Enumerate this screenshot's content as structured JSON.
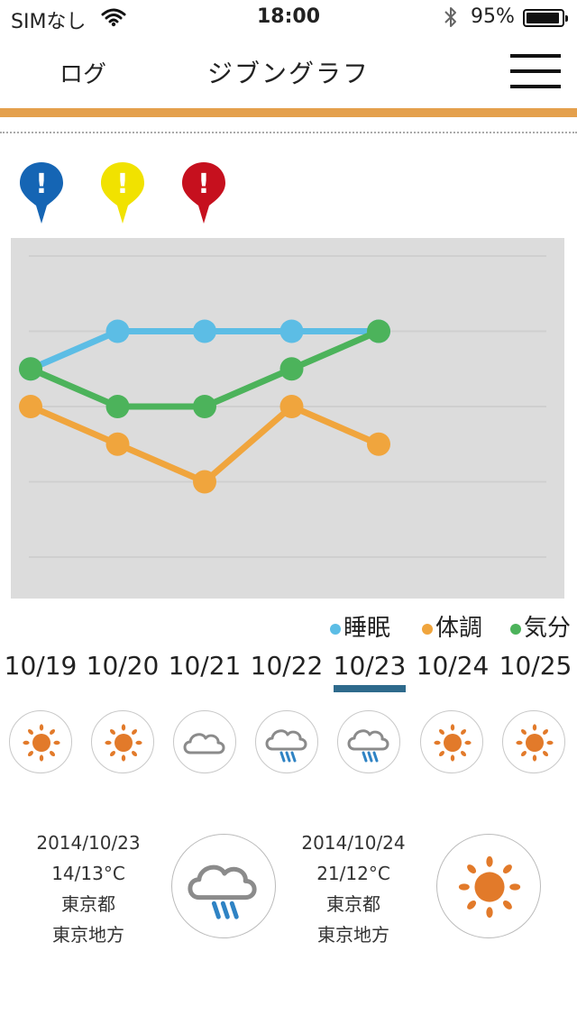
{
  "status_bar": {
    "carrier": "SIMなし",
    "time": "18:00",
    "battery_percent": "95%"
  },
  "nav": {
    "left_label": "ログ",
    "title": "ジブングラフ"
  },
  "alert_pins": [
    {
      "color": "#1565b4",
      "mark": "!"
    },
    {
      "color": "#f1e200",
      "mark": "!"
    },
    {
      "color": "#c6101e",
      "mark": "!"
    }
  ],
  "chart_data": {
    "type": "line",
    "categories": [
      "10/19",
      "10/20",
      "10/21",
      "10/22",
      "10/23"
    ],
    "ylim": [
      0,
      8
    ],
    "grid": true,
    "series": [
      {
        "name": "睡眠",
        "color": "#5cbde5",
        "values": [
          5,
          6,
          6,
          6,
          6
        ]
      },
      {
        "name": "体調",
        "color": "#f0a53d",
        "values": [
          4,
          3,
          2,
          4,
          3
        ]
      },
      {
        "name": "気分",
        "color": "#4cb35b",
        "values": [
          5,
          4,
          4,
          5,
          6
        ]
      }
    ]
  },
  "legend": [
    {
      "label": "睡眠",
      "color": "#5cbde5"
    },
    {
      "label": "体調",
      "color": "#f0a53d"
    },
    {
      "label": "気分",
      "color": "#4cb35b"
    }
  ],
  "dates": [
    "10/19",
    "10/20",
    "10/21",
    "10/22",
    "10/23",
    "10/24",
    "10/25"
  ],
  "selected_date": "10/23",
  "weather_week": [
    "sun-icon",
    "sun-icon",
    "cloud-icon",
    "rain-icon",
    "rain-icon",
    "sun-icon",
    "sun-icon"
  ],
  "forecast": [
    {
      "date": "2014/10/23",
      "temp": "14/13°C",
      "pref": "東京都",
      "area": "東京地方",
      "icon": "rain-icon"
    },
    {
      "date": "2014/10/24",
      "temp": "21/12°C",
      "pref": "東京都",
      "area": "東京地方",
      "icon": "sun-icon"
    }
  ],
  "colors": {
    "accent": "#e4a04d",
    "selected_underline": "#2e6a8c",
    "chart_bg": "#dcdcdc"
  }
}
